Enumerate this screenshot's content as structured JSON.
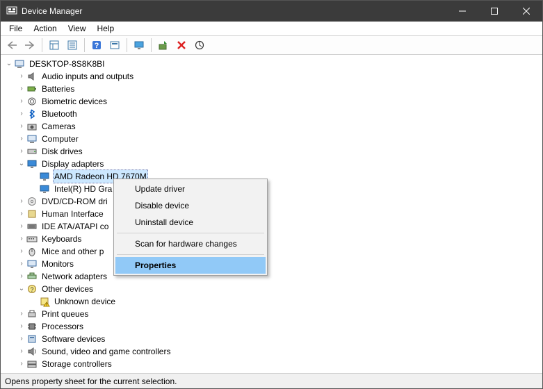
{
  "window": {
    "title": "Device Manager"
  },
  "menubar": {
    "items": [
      "File",
      "Action",
      "View",
      "Help"
    ]
  },
  "toolbar": {
    "buttons": [
      "back",
      "forward",
      "show-hidden",
      "properties-toolbar",
      "help",
      "app-toolbar",
      "monitor-toolbar",
      "update-driver-toolbar",
      "delete-toolbar",
      "scan-toolbar"
    ]
  },
  "tree": {
    "root": {
      "label": "DESKTOP-8S8K8BI",
      "icon": "computer-icon",
      "expanded": true,
      "children": [
        {
          "label": "Audio inputs and outputs",
          "icon": "audio-icon",
          "expanded": false,
          "hasChildren": true
        },
        {
          "label": "Batteries",
          "icon": "battery-icon",
          "expanded": false,
          "hasChildren": true
        },
        {
          "label": "Biometric devices",
          "icon": "biometric-icon",
          "expanded": false,
          "hasChildren": true
        },
        {
          "label": "Bluetooth",
          "icon": "bluetooth-icon",
          "expanded": false,
          "hasChildren": true
        },
        {
          "label": "Cameras",
          "icon": "camera-icon",
          "expanded": false,
          "hasChildren": true
        },
        {
          "label": "Computer",
          "icon": "computer-node-icon",
          "expanded": false,
          "hasChildren": true
        },
        {
          "label": "Disk drives",
          "icon": "disk-icon",
          "expanded": false,
          "hasChildren": true
        },
        {
          "label": "Display adapters",
          "icon": "display-icon",
          "expanded": true,
          "hasChildren": true,
          "children": [
            {
              "label": "AMD Radeon HD 7670M",
              "icon": "display-icon",
              "selected": true
            },
            {
              "label": "Intel(R) HD Gra",
              "icon": "display-icon"
            }
          ]
        },
        {
          "label": "DVD/CD-ROM dri",
          "icon": "dvd-icon",
          "expanded": false,
          "hasChildren": true
        },
        {
          "label": "Human Interface ",
          "icon": "hid-icon",
          "expanded": false,
          "hasChildren": true
        },
        {
          "label": "IDE ATA/ATAPI co",
          "icon": "ide-icon",
          "expanded": false,
          "hasChildren": true
        },
        {
          "label": "Keyboards",
          "icon": "keyboard-icon",
          "expanded": false,
          "hasChildren": true
        },
        {
          "label": "Mice and other p",
          "icon": "mouse-icon",
          "expanded": false,
          "hasChildren": true
        },
        {
          "label": "Monitors",
          "icon": "monitor-icon",
          "expanded": false,
          "hasChildren": true
        },
        {
          "label": "Network adapters",
          "icon": "network-icon",
          "expanded": false,
          "hasChildren": true
        },
        {
          "label": "Other devices",
          "icon": "other-icon",
          "expanded": true,
          "hasChildren": true,
          "children": [
            {
              "label": "Unknown device",
              "icon": "unknown-icon"
            }
          ]
        },
        {
          "label": "Print queues",
          "icon": "printer-icon",
          "expanded": false,
          "hasChildren": true
        },
        {
          "label": "Processors",
          "icon": "cpu-icon",
          "expanded": false,
          "hasChildren": true
        },
        {
          "label": "Software devices",
          "icon": "software-icon",
          "expanded": false,
          "hasChildren": true
        },
        {
          "label": "Sound, video and game controllers",
          "icon": "sound-icon",
          "expanded": false,
          "hasChildren": true
        },
        {
          "label": "Storage controllers",
          "icon": "storage-icon",
          "expanded": false,
          "hasChildren": true
        }
      ]
    }
  },
  "context_menu": {
    "items": [
      {
        "label": "Update driver",
        "type": "item"
      },
      {
        "label": "Disable device",
        "type": "item"
      },
      {
        "label": "Uninstall device",
        "type": "item"
      },
      {
        "type": "separator"
      },
      {
        "label": "Scan for hardware changes",
        "type": "item"
      },
      {
        "type": "separator"
      },
      {
        "label": "Properties",
        "type": "item",
        "highlighted": true
      }
    ]
  },
  "statusbar": {
    "text": "Opens property sheet for the current selection."
  }
}
